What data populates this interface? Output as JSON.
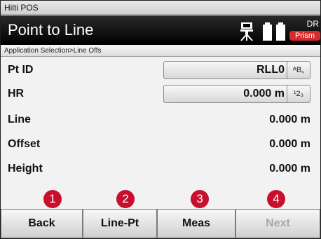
{
  "app": {
    "title": "Hilti POS"
  },
  "header": {
    "title": "Point to Line",
    "mode": "DR",
    "target": "Prism"
  },
  "breadcrumb": "Application Selection>Line Offs",
  "fields": {
    "pt_id": {
      "label": "Pt ID",
      "value": "RLL0",
      "mode": "ᴬB꜀"
    },
    "hr": {
      "label": "HR",
      "value": "0.000 m",
      "mode": "¹2₃"
    },
    "line": {
      "label": "Line",
      "value": "0.000 m"
    },
    "offset": {
      "label": "Offset",
      "value": "0.000 m"
    },
    "height": {
      "label": "Height",
      "value": "0.000 m"
    }
  },
  "softkeys": [
    {
      "label": "Back",
      "enabled": true
    },
    {
      "label": "Line-Pt",
      "enabled": true
    },
    {
      "label": "Meas",
      "enabled": true
    },
    {
      "label": "Next",
      "enabled": false
    }
  ],
  "markers": [
    "1",
    "2",
    "3",
    "4"
  ],
  "colors": {
    "accent": "#c8102e",
    "header_bg": "#000000",
    "prism_badge": "#d62b2b"
  }
}
